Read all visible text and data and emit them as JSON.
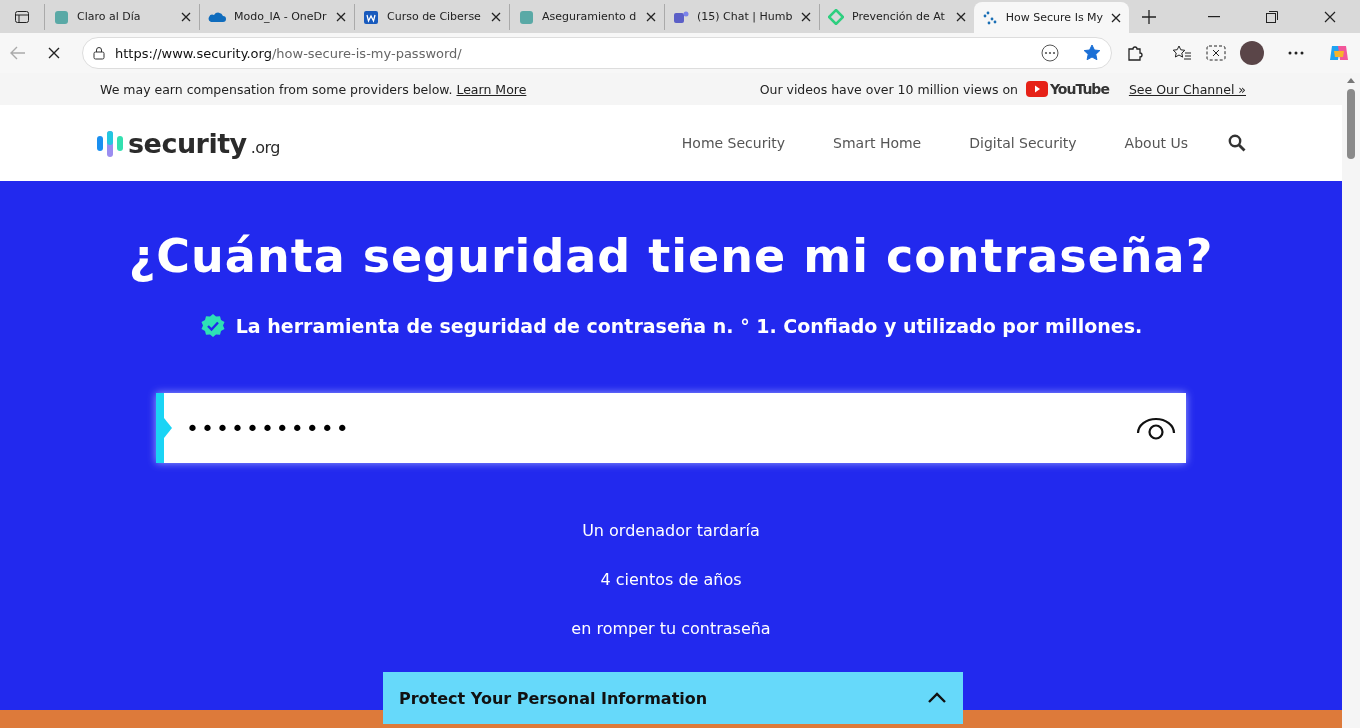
{
  "browser": {
    "tabs": [
      {
        "title": "Claro al Día",
        "selected": false
      },
      {
        "title": "Modo_IA - OneDr",
        "selected": false
      },
      {
        "title": "Curso de Ciberse",
        "selected": false
      },
      {
        "title": "Aseguramiento d",
        "selected": false
      },
      {
        "title": "(15) Chat | Humb",
        "selected": false
      },
      {
        "title": "Prevención de At",
        "selected": false
      },
      {
        "title": "How Secure Is My",
        "selected": true
      }
    ],
    "url_host": "https://www.security.org",
    "url_path": "/how-secure-is-my-password/",
    "favorite": true
  },
  "banner": {
    "text": "We may earn compensation from some providers below.",
    "link": "Learn More",
    "video_text": "Our videos have over 10 million views on",
    "youtube": "YouTube",
    "channel_link": "See Our Channel »"
  },
  "header": {
    "logo": "security",
    "logo_suffix": ".org",
    "nav": [
      "Home Security",
      "Smart Home",
      "Digital Security",
      "About Us"
    ]
  },
  "hero": {
    "title": "¿Cuánta seguridad tiene mi contraseña?",
    "subtitle": "La herramienta de seguridad de contraseña n. ° 1. Confiado y utilizado por millones.",
    "password": "•••••••••••",
    "result": [
      "Un ordenador tardaría",
      "4 cientos de años",
      "en romper tu contraseña"
    ]
  },
  "popup": {
    "title": "Protect Your Personal Information",
    "expanded": false
  }
}
